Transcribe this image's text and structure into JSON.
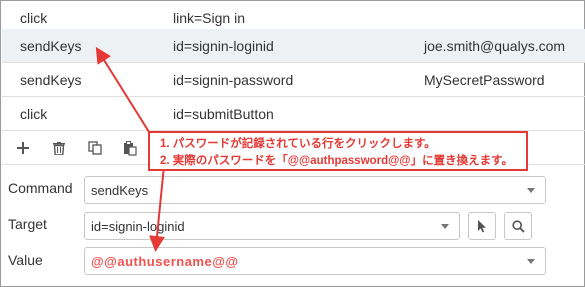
{
  "table": {
    "rows": [
      {
        "command": "click",
        "target": "link=Sign in",
        "value": "",
        "selected": false
      },
      {
        "command": "sendKeys",
        "target": "id=signin-loginid",
        "value": "joe.smith@qualys.com",
        "selected": true
      },
      {
        "command": "sendKeys",
        "target": "id=signin-password",
        "value": "MySecretPassword",
        "selected": false
      },
      {
        "command": "click",
        "target": "id=submitButton",
        "value": "",
        "selected": false
      }
    ]
  },
  "toolbar": {
    "icons": [
      "add-icon",
      "trash-icon",
      "copy-icon",
      "paste-icon"
    ]
  },
  "form": {
    "command_label": "Command",
    "command_value": "sendKeys",
    "target_label": "Target",
    "target_value": "id=signin-loginid",
    "value_label": "Value",
    "value_value": "@@authusername@@"
  },
  "annotation": {
    "line1": "1. パスワードが記録されている行をクリックします。",
    "line2": "2. 実際のパスワードを「@@authpassword@@」に置き換えます。",
    "color": "#e53935"
  }
}
